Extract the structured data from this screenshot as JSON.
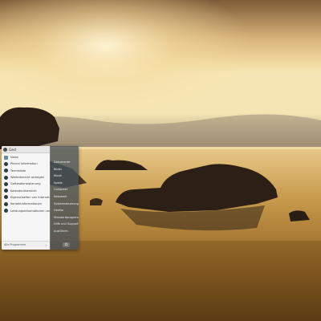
{
  "start_menu": {
    "user": {
      "name": "Gast"
    },
    "pinned_items": [
      {
        "label": "News",
        "icon": "folder-icon"
      },
      {
        "label": "Pfarrei Information",
        "icon": "app-icon"
      },
      {
        "label": "Terminliste",
        "icon": "app-icon"
      },
      {
        "label": "Wetterbericht anzeigen",
        "icon": "app-icon"
      },
      {
        "label": "Gottesdienstplanung",
        "icon": "app-icon"
      },
      {
        "label": "Kalenderübersicht",
        "icon": "app-icon"
      },
      {
        "label": "Eigenschaften von Internetexplorer",
        "icon": "app-icon"
      },
      {
        "label": "Kontaktinformationen",
        "icon": "app-icon"
      },
      {
        "label": "Leistungsinformationen und Tools",
        "icon": "app-icon"
      }
    ],
    "all_programs_label": "Alle Programme",
    "right_links": [
      "Dokumente",
      "Bilder",
      "Musik",
      "Spiele",
      "Computer",
      "Netzwerk",
      "Systemsteuerung",
      "Geräte",
      "Standardprogramme",
      "Hilfe und Support",
      "Ausführen"
    ],
    "power_glyph": "⏻"
  },
  "colors": {
    "left_pane": "#f6f6f6",
    "right_pane": "#46525c",
    "icon": "#2f3b44"
  }
}
